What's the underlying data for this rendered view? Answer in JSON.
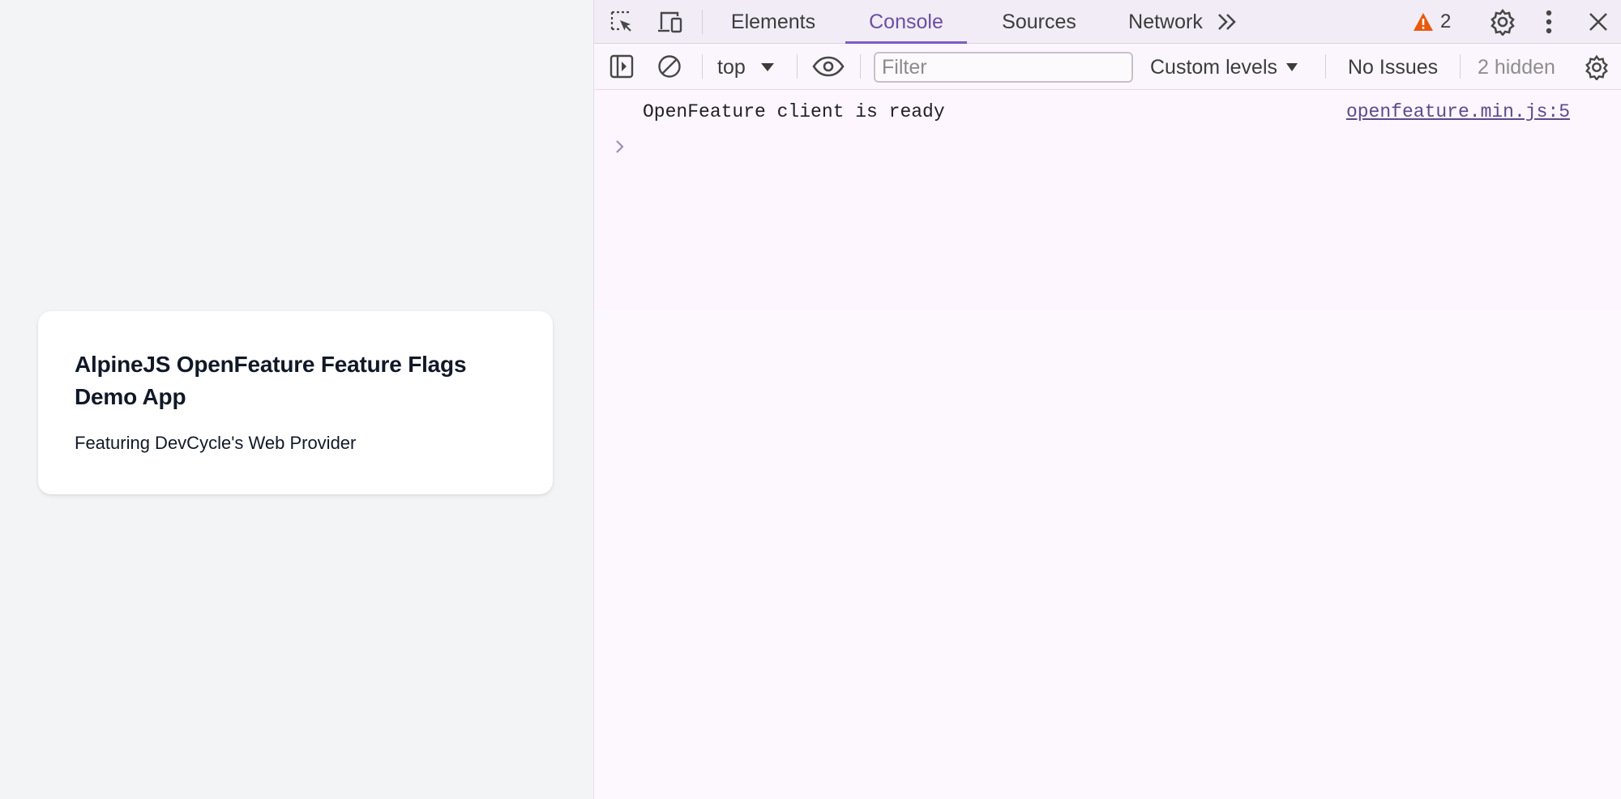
{
  "page": {
    "card_title": "AlpineJS OpenFeature Feature Flags Demo App",
    "card_subtitle": "Featuring DevCycle's Web Provider"
  },
  "devtools": {
    "tabs": [
      {
        "label": "Elements"
      },
      {
        "label": "Console"
      },
      {
        "label": "Sources"
      },
      {
        "label": "Network"
      }
    ],
    "active_tab": "Console",
    "warning_count": "2",
    "icons": {
      "inspect": "inspect-element-icon",
      "device": "device-toolbar-icon",
      "more_tabs": "more-tabs-icon",
      "warning": "warning-icon",
      "settings": "gear-icon",
      "menu": "kebab-menu-icon",
      "close": "close-icon"
    },
    "toolbar": {
      "context": "top",
      "filter_placeholder": "Filter",
      "levels": "Custom levels",
      "issues": "No Issues",
      "hidden": "2 hidden"
    },
    "console": {
      "messages": [
        {
          "text": "OpenFeature client is ready",
          "source": "openfeature.min.js:5"
        }
      ]
    },
    "colors": {
      "accent": "#7c5cc4",
      "warning": "#e8590c"
    }
  }
}
